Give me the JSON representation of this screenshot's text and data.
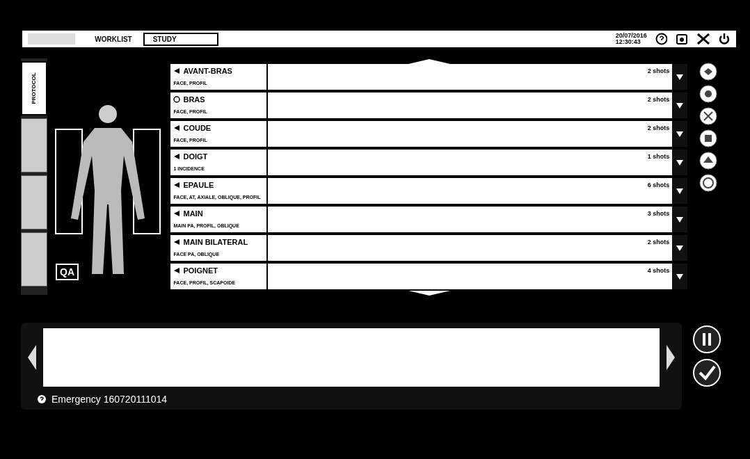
{
  "top_bar": {
    "worklist_button": "WORKLIST",
    "study_button": "STUDY",
    "date": "20/07/2016",
    "time": "12:30:43"
  },
  "side_tabs": [
    {
      "label": "PROTOCOL",
      "selected": true
    },
    {
      "selected": false
    },
    {
      "selected": false
    },
    {
      "selected": false
    }
  ],
  "qa_badge": "QA",
  "protocols": [
    {
      "name": "AVANT-BRAS",
      "views": "FACE, PROFIL",
      "shots": "2 shots",
      "kind": "arrow"
    },
    {
      "name": "BRAS",
      "views": "FACE, PROFIL",
      "shots": "2 shots",
      "kind": "circle"
    },
    {
      "name": "COUDE",
      "views": "FACE, PROFIL",
      "shots": "2 shots",
      "kind": "arrow"
    },
    {
      "name": "DOIGT",
      "views": "1 INCIDENCE",
      "shots": "1 shots",
      "kind": "arrow"
    },
    {
      "name": "EPAULE",
      "views": "FACE, AT, AXIALE, OBLIQUE, PROFIL",
      "shots": "6 shots",
      "kind": "arrow"
    },
    {
      "name": "MAIN",
      "views": "MAIN PA, PROFIL, OBLIQUE",
      "shots": "3 shots",
      "kind": "arrow"
    },
    {
      "name": "MAIN BILATERAL",
      "views": "FACE PA, OBLIQUE",
      "shots": "2 shots",
      "kind": "arrow"
    },
    {
      "name": "POIGNET",
      "views": "FACE, PROFIL, SCAPOIDE",
      "shots": "4 shots",
      "kind": "arrow"
    }
  ],
  "status": {
    "patient": "Emergency 160720111014"
  }
}
